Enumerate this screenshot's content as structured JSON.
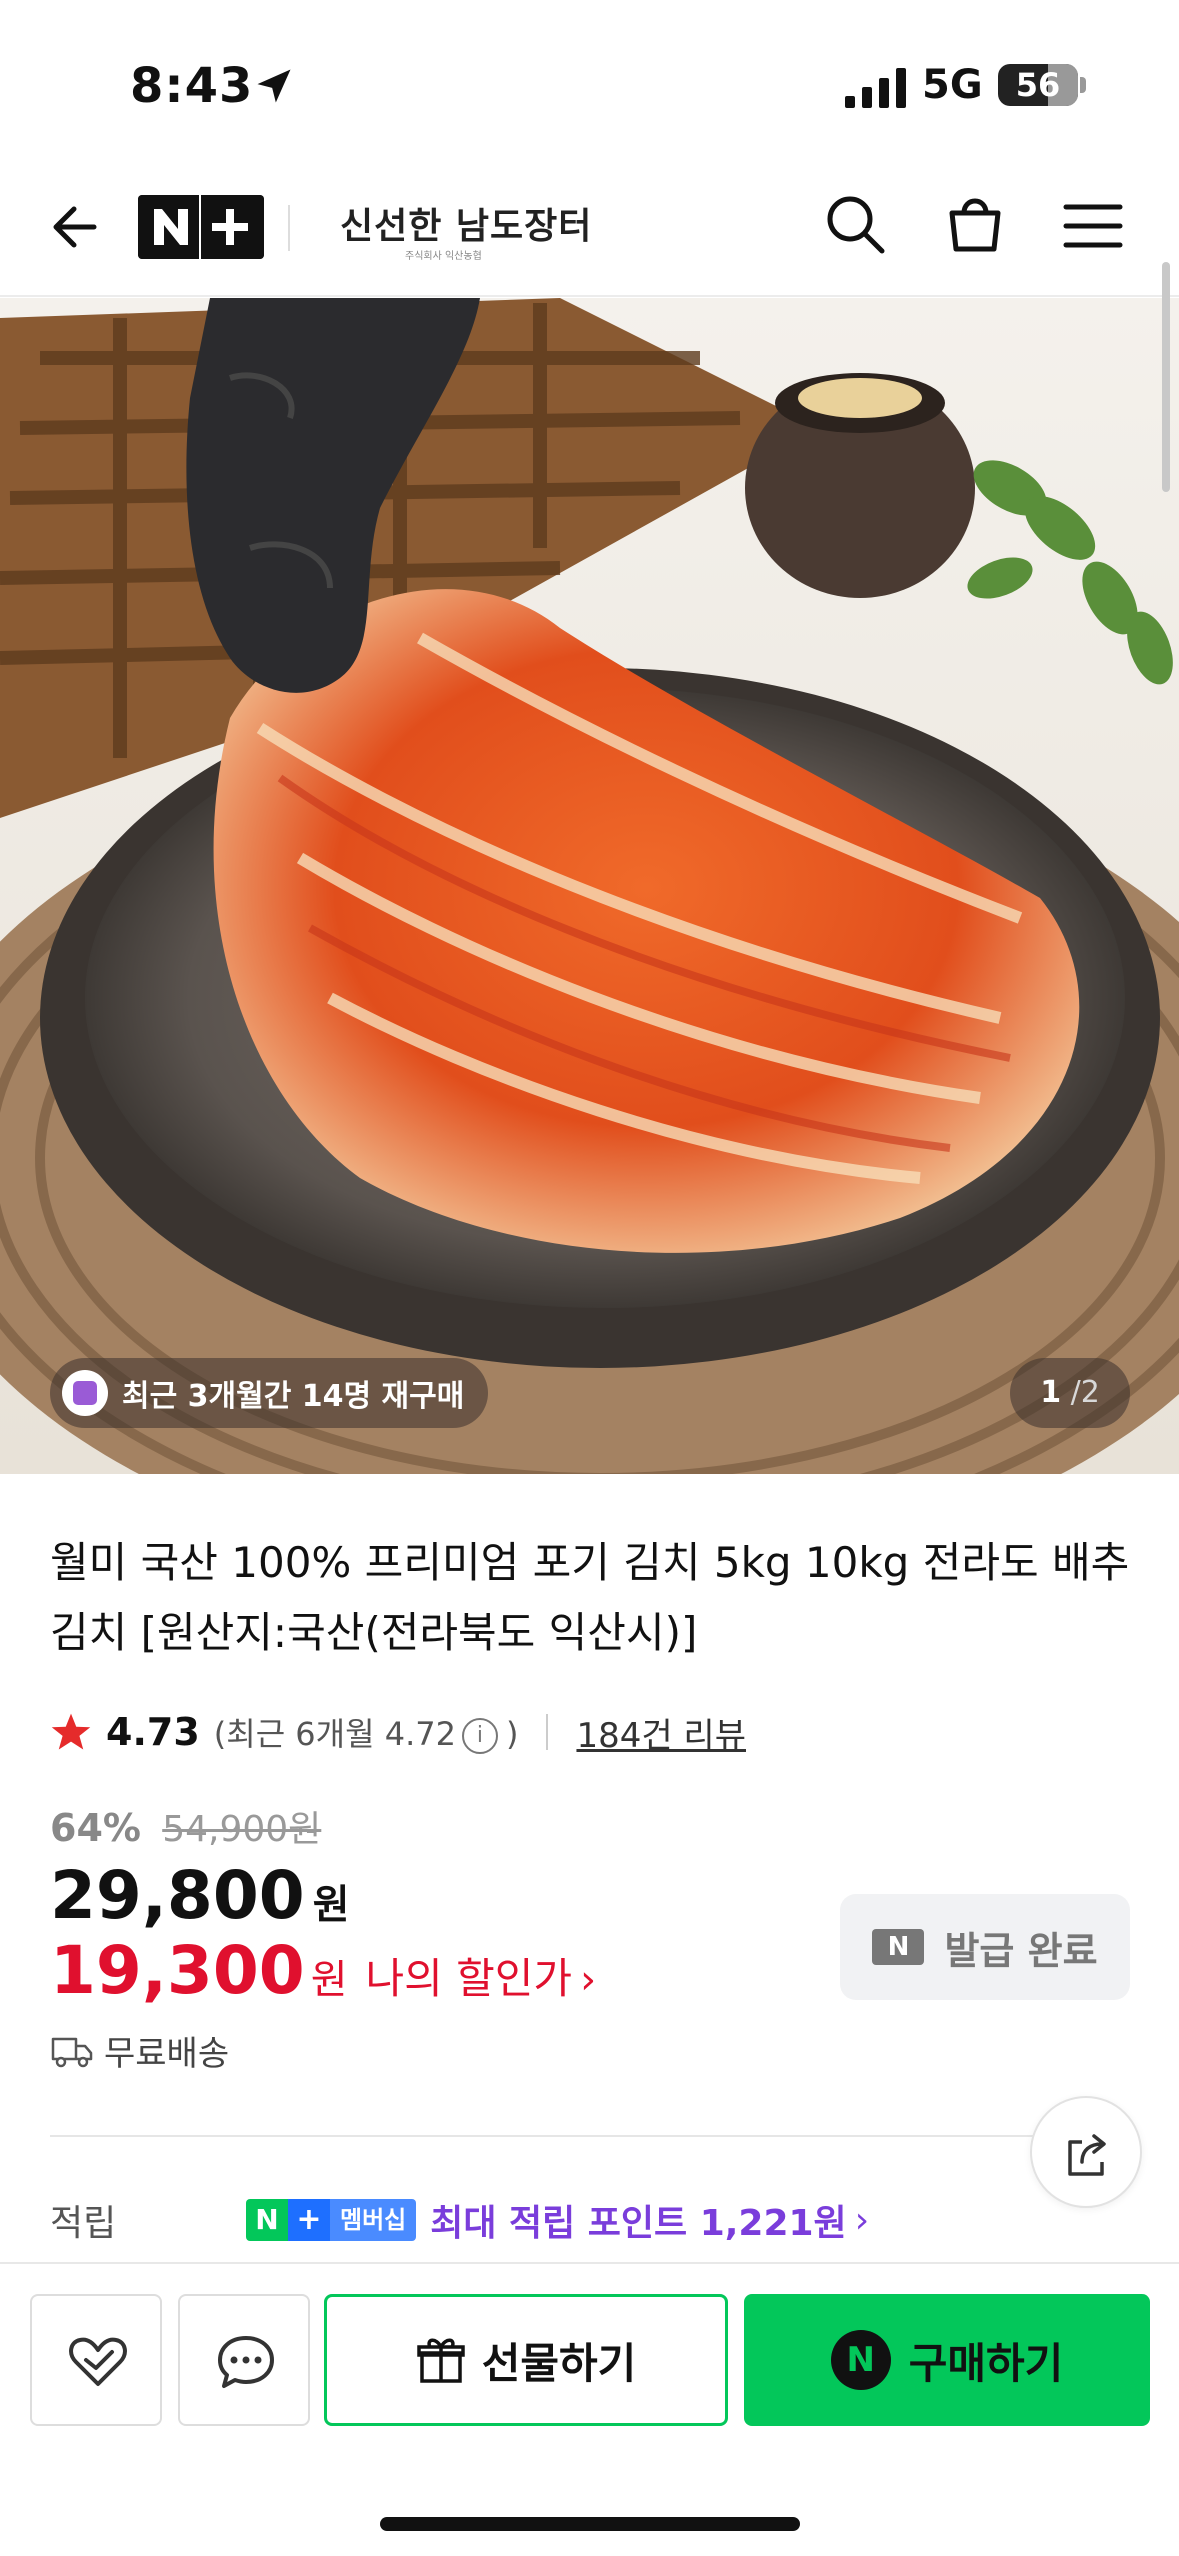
{
  "status_bar": {
    "time": "8:43",
    "network": "5G",
    "battery": "56"
  },
  "header": {
    "nplus_logo": "N+",
    "brand_name": "신선한 남도장터",
    "brand_sub": "주식회사 익산농협",
    "icons": [
      "back-arrow-icon",
      "search-icon",
      "shopping-bag-icon",
      "menu-icon"
    ]
  },
  "gallery": {
    "repurchase_text": "최근 3개월간 14명 재구매",
    "current": "1",
    "separator": "/",
    "total": "2"
  },
  "product": {
    "title": "월미 국산 100% 프리미엄 포기 김치 5kg 10kg 전라도 배추김치 [원산지:국산(전라북도 익산시)]",
    "rating": "4.73",
    "rating_recent_prefix": "(최근 6개월 4.72",
    "rating_recent_suffix": ")",
    "info_glyph": "i",
    "review_link": "184건 리뷰",
    "discount_rate": "64%",
    "original_price": "54,900원",
    "sale_price": "29,800",
    "sale_unit": "원",
    "my_price": "19,300",
    "my_price_unit": "원",
    "my_price_label": "나의 할인가",
    "chevron": "›",
    "coupon_badge": "N",
    "coupon_label": "발급 완료",
    "shipping": "무료배송"
  },
  "points": {
    "label": "적립",
    "badge_n": "N",
    "badge_plus": "+",
    "badge_text": "멤버십",
    "text": "최대 적립 포인트 1,221원",
    "chevron": "›"
  },
  "bottom_bar": {
    "gift_label": "선물하기",
    "buy_badge": "N",
    "buy_label": "구매하기"
  },
  "colors": {
    "naver_green": "#03c75a",
    "price_red": "#e0102e",
    "points_purple": "#7a3ddb"
  }
}
